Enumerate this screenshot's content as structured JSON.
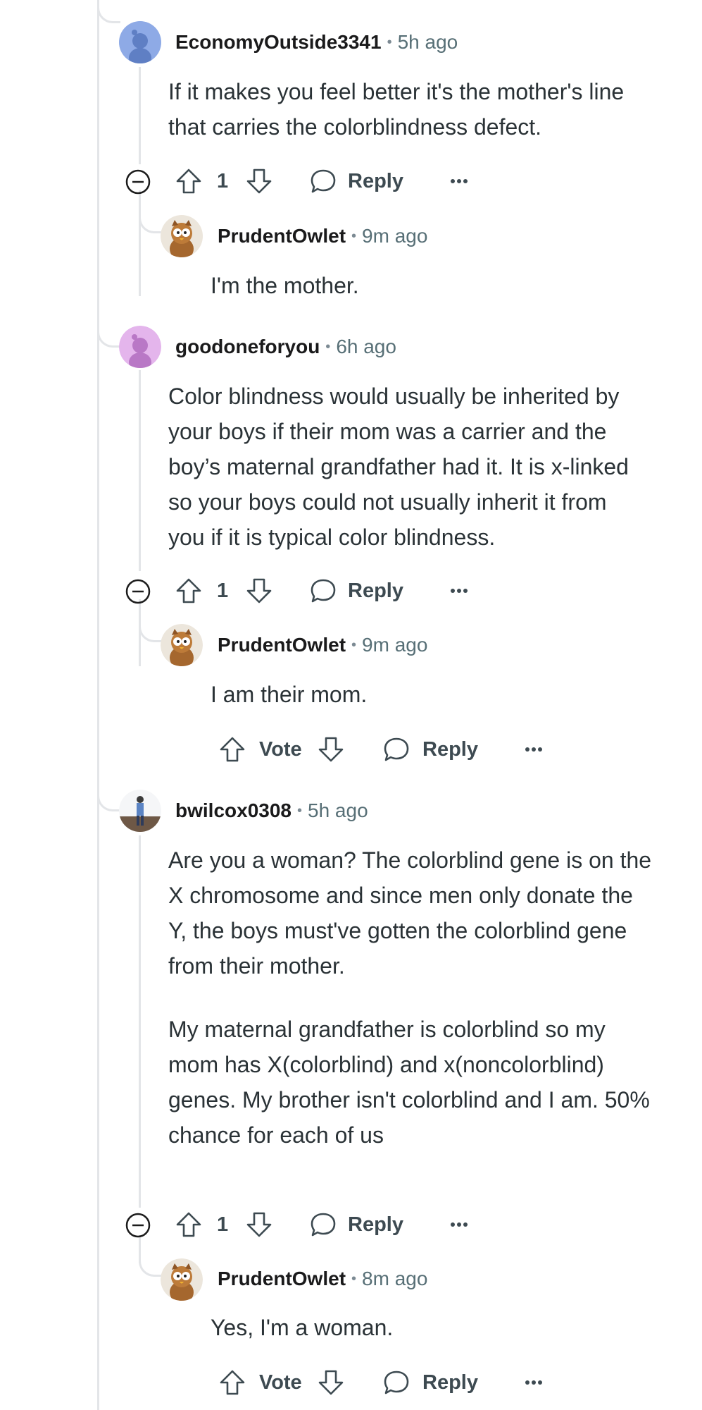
{
  "comments": [
    {
      "username": "EconomyOutside3341",
      "separator": "•",
      "time": "5h ago",
      "text": [
        "If it makes you feel better it's the mother's line that carries the colorblindness defect."
      ],
      "vote_count": "1",
      "reply_label": "Reply",
      "avatar": "snoo-avatar-blue",
      "reply": {
        "username": "PrudentOwlet",
        "separator": "•",
        "time": "9m ago",
        "text": "I'm the mother.",
        "avatar": "owl-avatar"
      }
    },
    {
      "username": "goodoneforyou",
      "separator": "•",
      "time": "6h ago",
      "text": [
        "Color blindness would usually be inherited by your boys if their mom was a carrier and the boy’s maternal grandfather had it. It is x-linked so your boys could not usually inherit it from you if it is typical color blindness."
      ],
      "vote_count": "1",
      "reply_label": "Reply",
      "avatar": "snoo-avatar-pink",
      "reply": {
        "username": "PrudentOwlet",
        "separator": "•",
        "time": "9m ago",
        "text": "I am their mom.",
        "avatar": "owl-avatar",
        "vote_label": "Vote",
        "reply_label": "Reply"
      }
    },
    {
      "username": "bwilcox0308",
      "separator": "•",
      "time": "5h ago",
      "text": [
        "Are you a woman? The colorblind gene is on the X chromosome and since men only donate the Y, the boys must've gotten the colorblind gene from their mother.",
        "My maternal grandfather is colorblind so my mom has X(colorblind) and x(noncolorblind) genes. My brother isn't colorblind and I am. 50% chance for each of us"
      ],
      "vote_count": "1",
      "reply_label": "Reply",
      "avatar": "photo-avatar",
      "reply": {
        "username": "PrudentOwlet",
        "separator": "•",
        "time": "8m ago",
        "text": "Yes, I'm a woman.",
        "avatar": "owl-avatar",
        "vote_label": "Vote",
        "reply_label": "Reply"
      }
    }
  ],
  "colors": {
    "thread_line": "#e3e5e8",
    "meta_text": "#576f76",
    "action_text": "#3d4a51"
  }
}
